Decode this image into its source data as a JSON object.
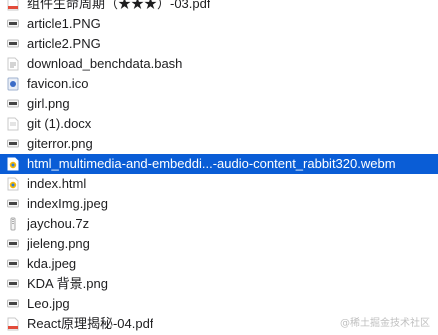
{
  "files": [
    {
      "name": "组件生命周期（★★★）-03.pdf",
      "icon": "pdf-icon"
    },
    {
      "name": "article1.PNG",
      "icon": "image-icon"
    },
    {
      "name": "article2.PNG",
      "icon": "image-icon"
    },
    {
      "name": "download_benchdata.bash",
      "icon": "script-file-icon"
    },
    {
      "name": "favicon.ico",
      "icon": "ico-icon"
    },
    {
      "name": "girl.png",
      "icon": "image-icon"
    },
    {
      "name": "git (1).docx",
      "icon": "docx-icon"
    },
    {
      "name": "giterror.png",
      "icon": "image-icon"
    },
    {
      "name": "html_multimedia-and-embeddi...-audio-content_rabbit320.webm",
      "icon": "chrome-file-icon",
      "selected": true
    },
    {
      "name": "index.html",
      "icon": "chrome-file-icon"
    },
    {
      "name": "indexImg.jpeg",
      "icon": "image-icon"
    },
    {
      "name": "jaychou.7z",
      "icon": "archive-icon"
    },
    {
      "name": "jieleng.png",
      "icon": "image-icon"
    },
    {
      "name": "kda.jpeg",
      "icon": "image-icon"
    },
    {
      "name": "KDA 背景.png",
      "icon": "image-icon"
    },
    {
      "name": "Leo.jpg",
      "icon": "image-icon"
    },
    {
      "name": "React原理揭秘-04.pdf",
      "icon": "pdf-icon"
    }
  ],
  "watermark": "@稀土掘金技术社区",
  "colors": {
    "selection": "#0a5dd6",
    "text": "#1d1d1f",
    "selected_text": "#ffffff"
  }
}
